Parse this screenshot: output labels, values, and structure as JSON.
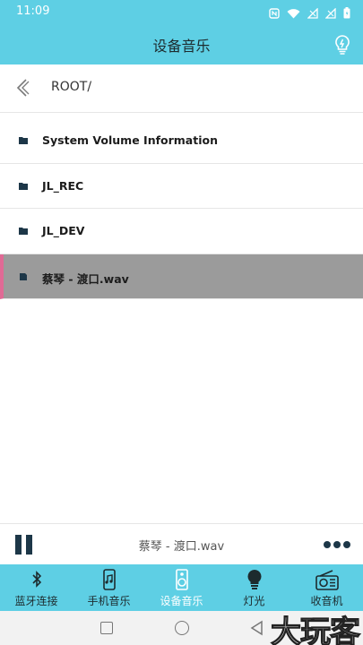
{
  "status": {
    "time": "11:09",
    "icons": [
      "nfc-icon",
      "wifi-icon",
      "no-sim-icon",
      "no-sim-icon",
      "battery-icon"
    ]
  },
  "header": {
    "title": "设备音乐",
    "action_icon": "lightbulb-icon"
  },
  "path": {
    "back_icon": "chevron-left-icon",
    "text": "ROOT/"
  },
  "files": [
    {
      "name": "System Volume Information",
      "type": "folder",
      "selected": false
    },
    {
      "name": "JL_REC",
      "type": "folder",
      "selected": false
    },
    {
      "name": "JL_DEV",
      "type": "folder",
      "selected": false
    },
    {
      "name": "蔡琴 - 渡口.wav",
      "type": "file",
      "selected": true
    }
  ],
  "player": {
    "track": "蔡琴 - 渡口.wav",
    "play_state_icon": "pause-icon",
    "more_icon": "more-icon"
  },
  "tabs": [
    {
      "label": "蓝牙连接",
      "icon": "bluetooth-icon",
      "active": false
    },
    {
      "label": "手机音乐",
      "icon": "phone-music-icon",
      "active": false
    },
    {
      "label": "设备音乐",
      "icon": "speaker-icon",
      "active": true
    },
    {
      "label": "灯光",
      "icon": "lightbulb-icon",
      "active": false
    },
    {
      "label": "收音机",
      "icon": "radio-icon",
      "active": false
    }
  ],
  "watermark": "大玩客",
  "colors": {
    "accent": "#5ecfe4",
    "selected_row": "#9b9b9b",
    "selected_marker": "#e06a95",
    "icon_dark": "#1d3748"
  }
}
